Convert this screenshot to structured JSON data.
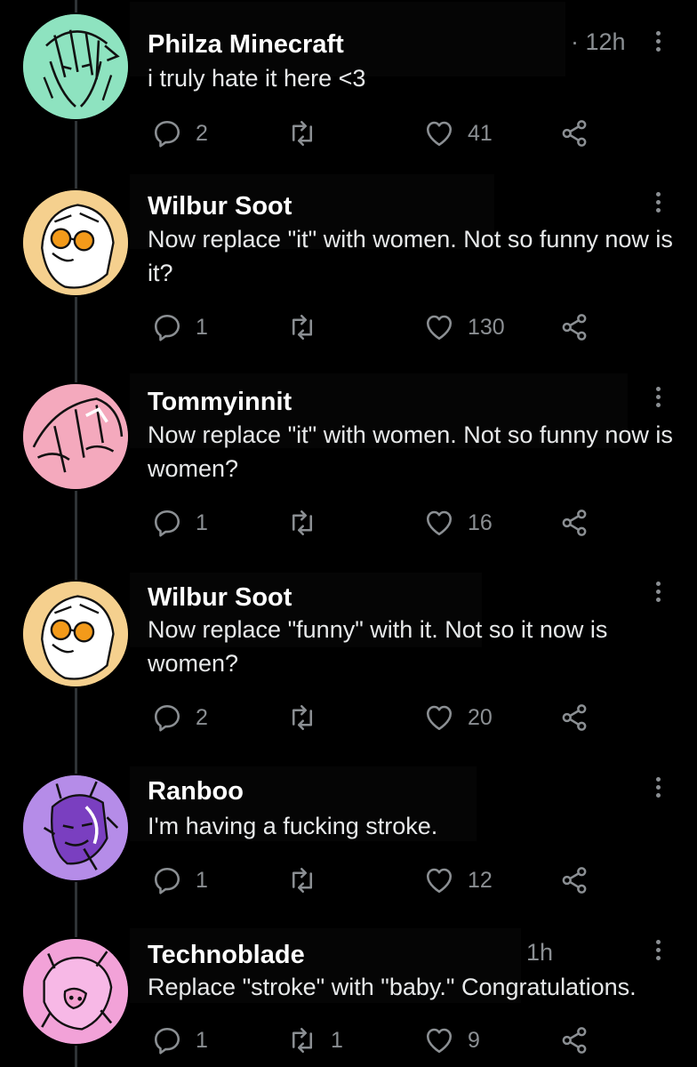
{
  "colors": {
    "background": "#000000",
    "text": "#e7e9ea",
    "muted": "#8b8f93"
  },
  "icons": {
    "reply": "reply-icon",
    "retweet": "retweet-icon",
    "like": "heart-icon",
    "share": "share-icon",
    "more": "more-icon"
  },
  "tweets": [
    {
      "author": "Philza Minecraft",
      "time": "· 12h",
      "text": "i truly hate it here <3",
      "replies": "2",
      "retweets": "",
      "likes": "41",
      "avatar_color": "#8ee3c0"
    },
    {
      "author": "Wilbur Soot",
      "time": "",
      "text": "Now replace \"it\" with women. Not so funny now is it?",
      "replies": "1",
      "retweets": "",
      "likes": "130",
      "avatar_color": "#f5d08e"
    },
    {
      "author": "Tommyinnit",
      "time": "",
      "text": "Now replace \"it\" with women. Not so funny now is women?",
      "replies": "1",
      "retweets": "",
      "likes": "16",
      "avatar_color": "#f4a9bd"
    },
    {
      "author": "Wilbur Soot",
      "time": "",
      "text": "Now replace \"funny\" with it. Not so it now is women?",
      "replies": "2",
      "retweets": "",
      "likes": "20",
      "avatar_color": "#f5d08e"
    },
    {
      "author": "Ranboo",
      "time": "",
      "text": "I'm having a fucking stroke.",
      "replies": "1",
      "retweets": "",
      "likes": "12",
      "avatar_color": "#b58ce8"
    },
    {
      "author": "Technoblade",
      "time": "1h",
      "text": "Replace \"stroke\" with \"baby.\" Congratulations.",
      "replies": "1",
      "retweets": "1",
      "likes": "9",
      "avatar_color": "#f2a2d8"
    }
  ]
}
